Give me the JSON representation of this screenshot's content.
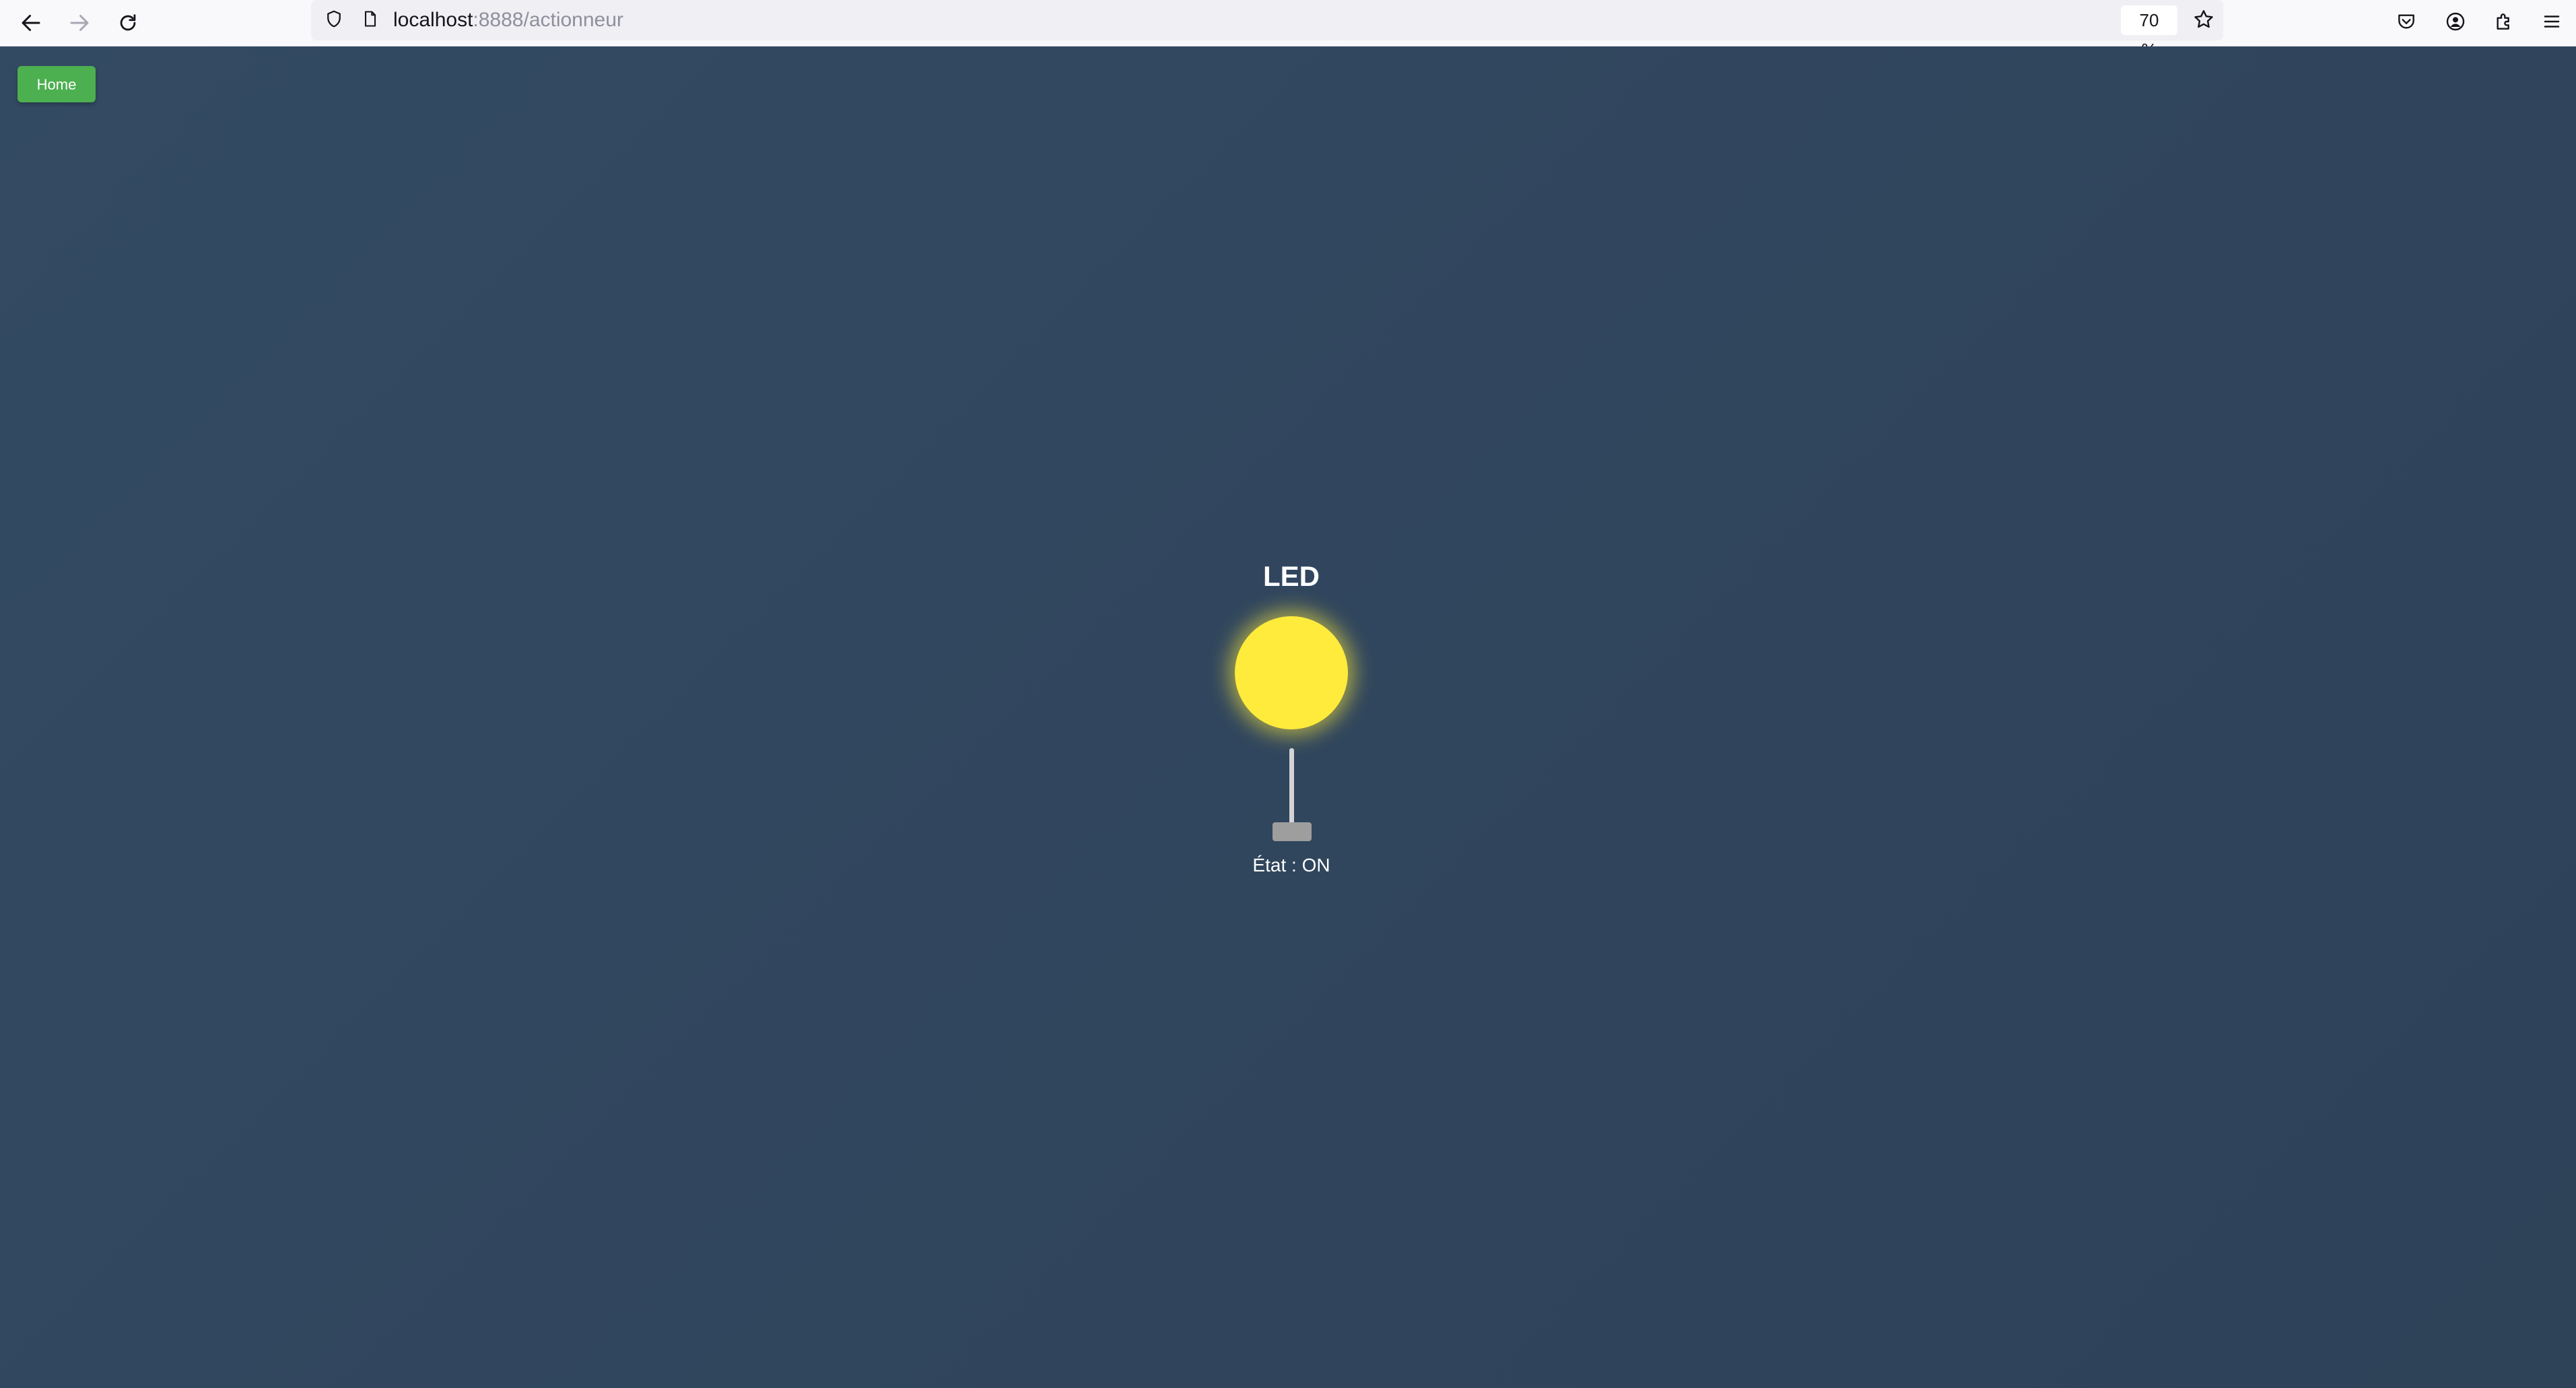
{
  "browser": {
    "url_host": "localhost",
    "url_path": ":8888/actionneur",
    "zoom": "70 %",
    "icons": {
      "back": "back-arrow-icon",
      "forward": "forward-arrow-icon",
      "reload": "reload-icon",
      "tracking": "shield-icon",
      "page": "page-icon",
      "bookmark": "star-icon",
      "pocket": "pocket-icon",
      "account": "account-icon",
      "extensions": "extensions-icon",
      "menu": "hamburger-menu-icon"
    }
  },
  "page": {
    "home_label": "Home",
    "led_title": "LED",
    "led_state": "État : ON",
    "led_on": true,
    "colors": {
      "background": "#334a63",
      "home_button": "#4caf50",
      "led_on": "#ffeb3b",
      "switch_stick": "#d4d4d4",
      "switch_base": "#9e9e9e"
    }
  }
}
